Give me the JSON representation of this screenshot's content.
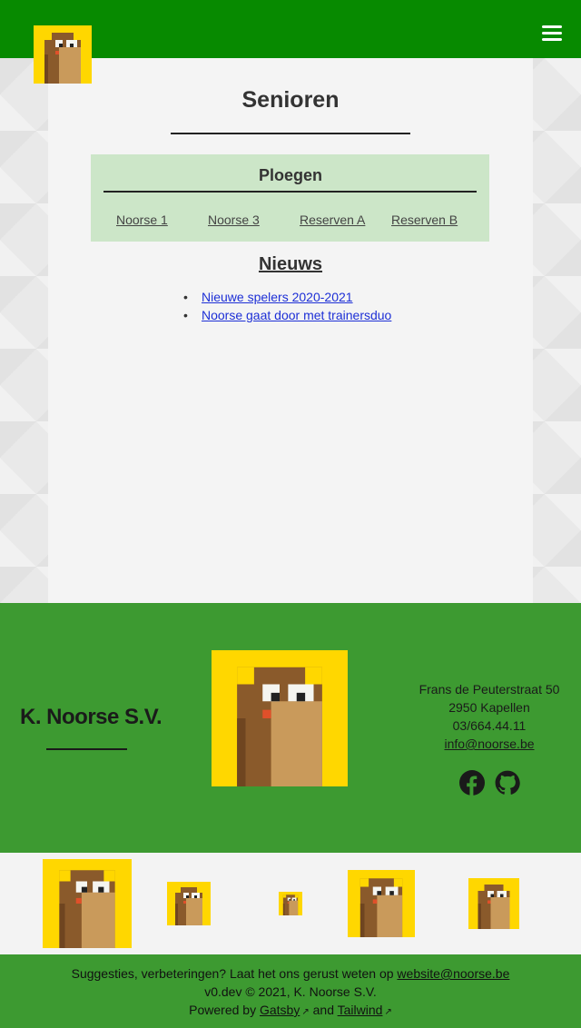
{
  "header": {
    "menu_icon": "hamburger-menu-icon",
    "logo_icon": "beaver-logo-icon"
  },
  "main": {
    "title": "Senioren",
    "teams": {
      "title": "Ploegen",
      "items": [
        "Noorse 1",
        "Noorse 3",
        "Reserven A",
        "Reserven B"
      ]
    },
    "news": {
      "title": "Nieuws",
      "items": [
        "Nieuwe spelers 2020-2021",
        "Noorse gaat door met trainersduo"
      ]
    }
  },
  "footer": {
    "club_name": "K. Noorse S.V.",
    "address": {
      "street": "Frans de Peuterstraat 50",
      "city": "2950 Kapellen",
      "phone": "03/664.44.11",
      "email": "info@noorse.be"
    },
    "social": [
      {
        "name": "facebook-icon"
      },
      {
        "name": "github-icon"
      }
    ]
  },
  "bottom": {
    "suggest_text": "Suggesties, verbeteringen? Laat het ons gerust weten op",
    "suggest_email": "website@noorse.be",
    "version": "v0.dev © 2021, K. Noorse S.V.",
    "powered_prefix": "Powered by",
    "gatsby": "Gatsby",
    "and": "and",
    "tailwind": "Tailwind"
  },
  "colors": {
    "header_green": "#078a00",
    "footer_green": "#3d9a31",
    "teams_box": "#cce6c8",
    "logo_yellow": "#ffd700",
    "beaver_brown": "#8a5a2b"
  }
}
